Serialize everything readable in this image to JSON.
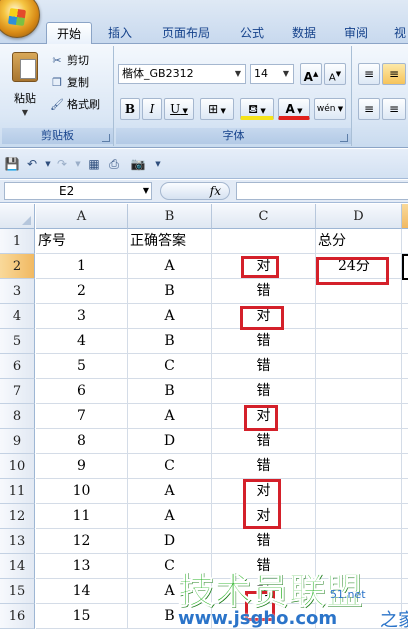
{
  "ribbon": {
    "tabs": [
      "开始",
      "插入",
      "页面布局",
      "公式",
      "数据",
      "审阅",
      "视"
    ],
    "clipboard": {
      "paste_label": "粘贴",
      "cut_label": "剪切",
      "copy_label": "复制",
      "format_painter_label": "格式刷",
      "group_label": "剪贴板"
    },
    "font": {
      "font_name": "楷体_GB2312",
      "font_size": "14",
      "grow_label": "A",
      "shrink_label": "A",
      "bold_label": "B",
      "italic_label": "I",
      "underline_label": "U",
      "font_color_label": "A",
      "phonetic_label": "wén",
      "group_label": "字体"
    }
  },
  "formula_bar": {
    "name_box": "E2",
    "fx_label": "fx",
    "formula": ""
  },
  "sheet": {
    "columns": [
      "A",
      "B",
      "C",
      "D"
    ],
    "rows": [
      {
        "num": "1",
        "a": "序号",
        "b": "正确答案",
        "c": "",
        "d": "总分"
      },
      {
        "num": "2",
        "a": "1",
        "b": "A",
        "c": "对",
        "d": "24分"
      },
      {
        "num": "3",
        "a": "2",
        "b": "B",
        "c": "错",
        "d": ""
      },
      {
        "num": "4",
        "a": "3",
        "b": "A",
        "c": "对",
        "d": ""
      },
      {
        "num": "5",
        "a": "4",
        "b": "B",
        "c": "错",
        "d": ""
      },
      {
        "num": "6",
        "a": "5",
        "b": "C",
        "c": "错",
        "d": ""
      },
      {
        "num": "7",
        "a": "6",
        "b": "B",
        "c": "错",
        "d": ""
      },
      {
        "num": "8",
        "a": "7",
        "b": "A",
        "c": "对",
        "d": ""
      },
      {
        "num": "9",
        "a": "8",
        "b": "D",
        "c": "错",
        "d": ""
      },
      {
        "num": "10",
        "a": "9",
        "b": "C",
        "c": "错",
        "d": ""
      },
      {
        "num": "11",
        "a": "10",
        "b": "A",
        "c": "对",
        "d": ""
      },
      {
        "num": "12",
        "a": "11",
        "b": "A",
        "c": "对",
        "d": ""
      },
      {
        "num": "13",
        "a": "12",
        "b": "D",
        "c": "错",
        "d": ""
      },
      {
        "num": "14",
        "a": "13",
        "b": "C",
        "c": "错",
        "d": ""
      },
      {
        "num": "15",
        "a": "14",
        "b": "A",
        "c": "对",
        "d": ""
      },
      {
        "num": "16",
        "a": "15",
        "b": "B",
        "c": "",
        "d": ""
      }
    ],
    "highlight_color": "#d4202a"
  },
  "watermark": {
    "text": "技术员联盟",
    "url": "www.jsgho.com",
    "suffix": "之家",
    "net": "51.net"
  }
}
